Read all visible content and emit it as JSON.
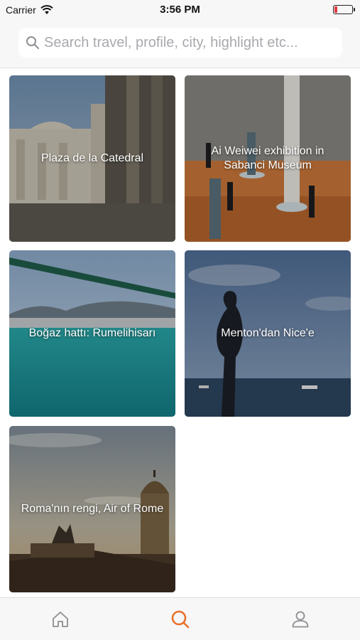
{
  "status_bar": {
    "carrier": "Carrier",
    "time": "3:56 PM",
    "battery_level": 0.15,
    "battery_color": "#e0383e"
  },
  "search": {
    "placeholder": "Search travel, profile, city, highlight etc...",
    "icon": "search-icon"
  },
  "travels": [
    {
      "title": "Plaza de la Catedral"
    },
    {
      "title": "Ai Weiwei exhibition in Sabanci Museum"
    },
    {
      "title": "Boğaz hattı: Rumelihisarı"
    },
    {
      "title": "Menton'dan Nice'e"
    },
    {
      "title": "Roma'nın rengi, Air of Rome"
    }
  ],
  "tab_bar": {
    "tabs": [
      {
        "name": "home",
        "icon": "home-icon",
        "active": false
      },
      {
        "name": "search",
        "icon": "search-icon",
        "active": true
      },
      {
        "name": "profile",
        "icon": "profile-icon",
        "active": false
      }
    ],
    "active_color": "#e8702a",
    "inactive_color": "#8e8e93"
  }
}
